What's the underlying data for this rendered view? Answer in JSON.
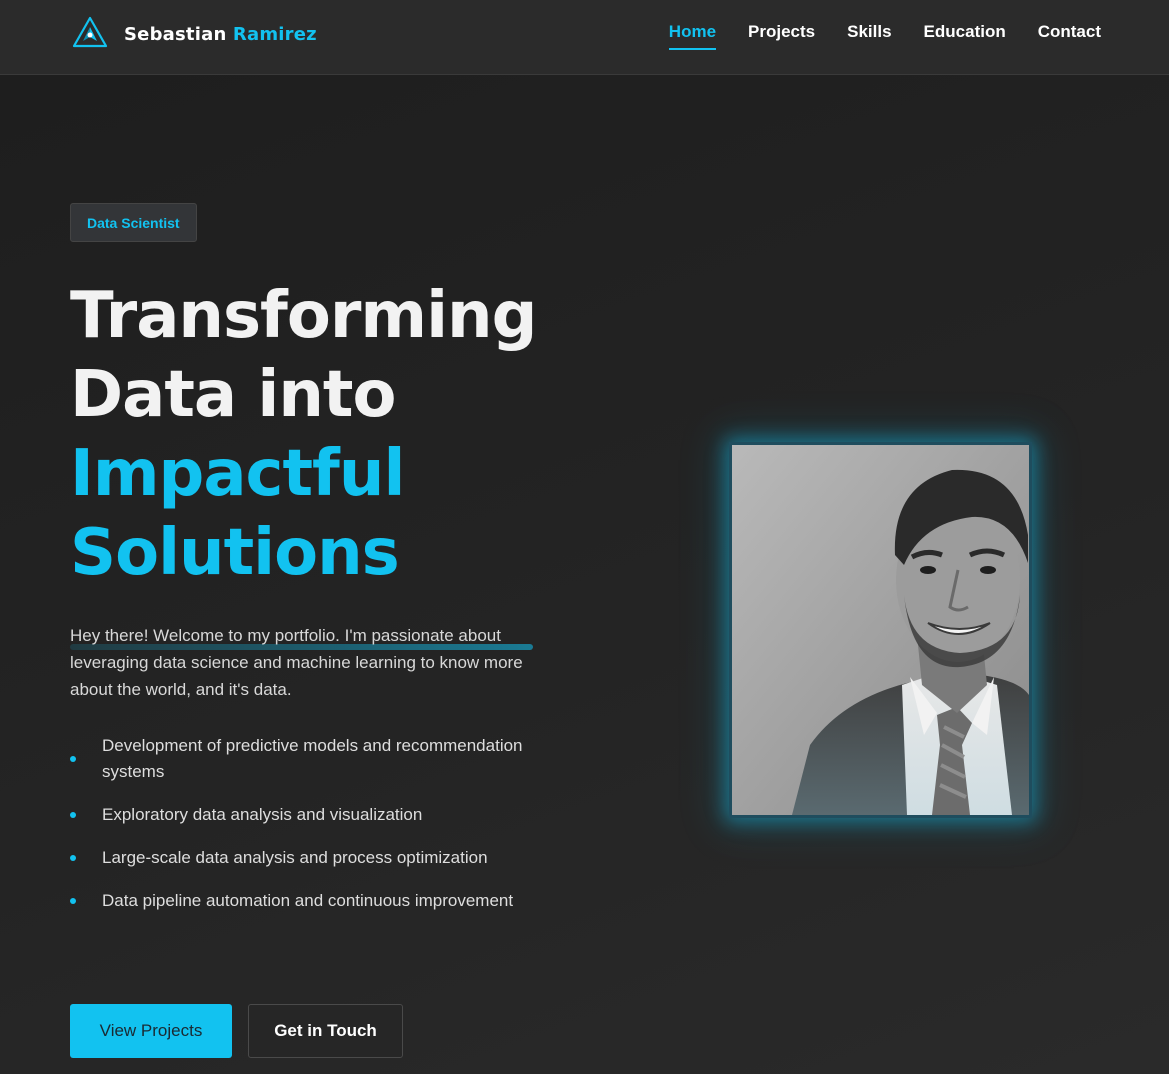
{
  "brand": {
    "first_name": "Sebastian",
    "last_name": "Ramirez"
  },
  "nav": {
    "items": [
      {
        "label": "Home",
        "active": true
      },
      {
        "label": "Projects",
        "active": false
      },
      {
        "label": "Skills",
        "active": false
      },
      {
        "label": "Education",
        "active": false
      },
      {
        "label": "Contact",
        "active": false
      }
    ]
  },
  "hero": {
    "badge": "Data Scientist",
    "headline": {
      "line1": "Transforming",
      "line2": "Data into",
      "line3": "Impactful",
      "line4": "Solutions"
    },
    "intro": "Hey there! Welcome to my portfolio. I'm passionate about leveraging data science and machine learning to know more about the world, and it's data.",
    "features": [
      "Development of predictive models and recommendation systems",
      "Exploratory data analysis and visualization",
      "Large-scale data analysis and process optimization",
      "Data pipeline automation and continuous improvement"
    ],
    "buttons": {
      "primary": "View Projects",
      "secondary": "Get in Touch"
    }
  },
  "colors": {
    "accent": "#12c2f0",
    "background": "#242424",
    "header": "#2b2b2b"
  },
  "icons": {
    "logo": "triangle-logo-icon",
    "bullet": "dot-icon"
  }
}
